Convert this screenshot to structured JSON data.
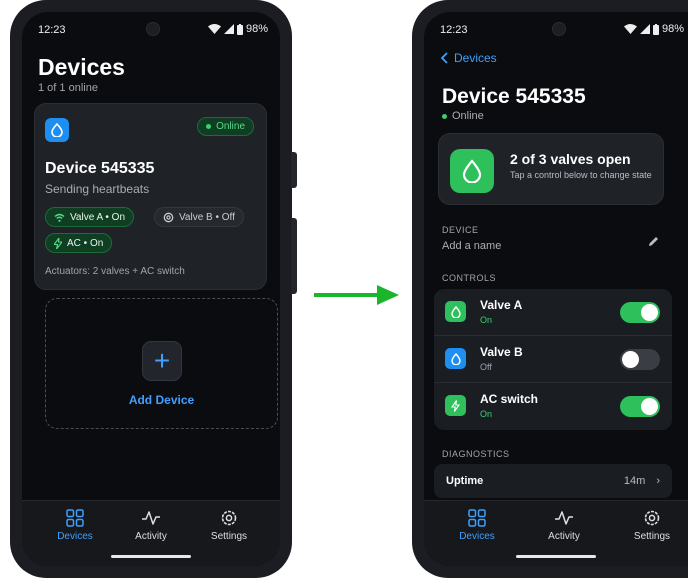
{
  "status_bar": {
    "time": "12:23",
    "battery": "98%"
  },
  "devices_screen": {
    "title": "Devices",
    "subtitle": "1 of 1 online",
    "device_card": {
      "online_badge": "Online",
      "name": "Device 545335",
      "status": "Sending heartbeats",
      "chips": [
        {
          "label": "Valve A • On",
          "state": "on"
        },
        {
          "label": "Valve B • Off",
          "state": "off"
        },
        {
          "label": "AC • On",
          "state": "on"
        }
      ],
      "footer": "Actuators: 2 valves + AC switch"
    },
    "add_device_label": "Add Device"
  },
  "tabs": [
    {
      "label": "Devices",
      "icon": "grid-icon"
    },
    {
      "label": "Activity",
      "icon": "pulse-icon"
    },
    {
      "label": "Settings",
      "icon": "gear-icon"
    }
  ],
  "detail_screen": {
    "back_label": "Devices",
    "title": "Device 545335",
    "online": "Online",
    "summary": {
      "title": "2 of 3 valves open",
      "subtitle": "Tap a control below to change state"
    },
    "device_section": "DEVICE",
    "name_placeholder": "Add a name",
    "controls_section": "CONTROLS",
    "controls": [
      {
        "name": "Valve A",
        "state": "On",
        "on": true,
        "icon": "droplet-icon"
      },
      {
        "name": "Valve B",
        "state": "Off",
        "on": false,
        "icon": "droplet-icon"
      },
      {
        "name": "AC switch",
        "state": "On",
        "on": true,
        "icon": "bolt-icon"
      }
    ],
    "diagnostics_section": "DIAGNOSTICS",
    "uptime": {
      "label": "Uptime",
      "value": "14m"
    }
  },
  "colors": {
    "accent_blue": "#3fa0ff",
    "accent_green": "#2ec05b",
    "arrow_green": "#19b52b"
  }
}
